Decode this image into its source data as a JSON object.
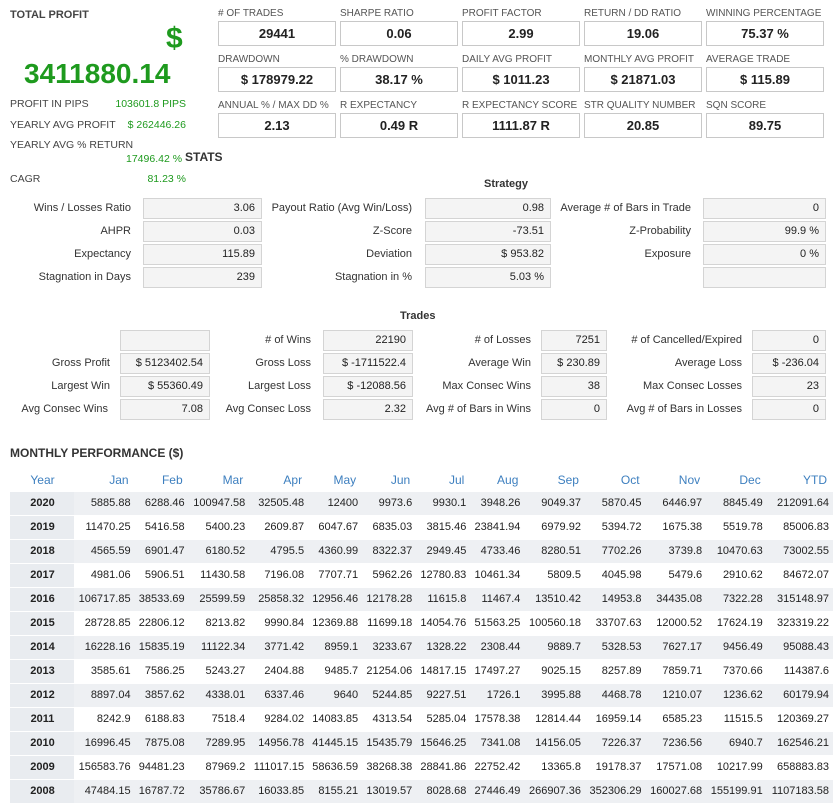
{
  "summary": {
    "title": "TOTAL PROFIT",
    "currency_symbol": "$",
    "total_profit": "3411880.14",
    "rows": [
      {
        "label": "PROFIT IN PIPS",
        "value": "103601.8 PIPS"
      },
      {
        "label": "YEARLY AVG PROFIT",
        "value": "$ 262446.26"
      },
      {
        "label": "YEARLY AVG % RETURN",
        "value": "17496.42 %"
      },
      {
        "label": "CAGR",
        "value": "81.23 %"
      }
    ]
  },
  "metrics": [
    {
      "label": "# OF TRADES",
      "value": "29441"
    },
    {
      "label": "SHARPE RATIO",
      "value": "0.06"
    },
    {
      "label": "PROFIT FACTOR",
      "value": "2.99"
    },
    {
      "label": "RETURN / DD RATIO",
      "value": "19.06"
    },
    {
      "label": "WINNING PERCENTAGE",
      "value": "75.37 %"
    },
    {
      "label": "DRAWDOWN",
      "value": "$ 178979.22"
    },
    {
      "label": "% DRAWDOWN",
      "value": "38.17 %"
    },
    {
      "label": "DAILY AVG PROFIT",
      "value": "$ 1011.23"
    },
    {
      "label": "MONTHLY AVG PROFIT",
      "value": "$ 21871.03"
    },
    {
      "label": "AVERAGE TRADE",
      "value": "$ 115.89"
    },
    {
      "label": "ANNUAL % / MAX DD %",
      "value": "2.13"
    },
    {
      "label": "R EXPECTANCY",
      "value": "0.49 R"
    },
    {
      "label": "R EXPECTANCY SCORE",
      "value": "1111.87 R"
    },
    {
      "label": "STR QUALITY NUMBER",
      "value": "20.85"
    },
    {
      "label": "SQN SCORE",
      "value": "89.75"
    }
  ],
  "stats_title": "STATS",
  "strategy": {
    "title": "Strategy",
    "rows": [
      [
        {
          "label": "Wins / Losses Ratio",
          "value": "3.06"
        },
        {
          "label": "Payout Ratio (Avg Win/Loss)",
          "value": "0.98"
        },
        {
          "label": "Average # of Bars in Trade",
          "value": "0"
        }
      ],
      [
        {
          "label": "AHPR",
          "value": "0.03"
        },
        {
          "label": "Z-Score",
          "value": "-73.51"
        },
        {
          "label": "Z-Probability",
          "value": "99.9 %"
        }
      ],
      [
        {
          "label": "Expectancy",
          "value": "115.89"
        },
        {
          "label": "Deviation",
          "value": "$ 953.82"
        },
        {
          "label": "Exposure",
          "value": "0 %"
        }
      ],
      [
        {
          "label": "Stagnation in Days",
          "value": "239"
        },
        {
          "label": "Stagnation in %",
          "value": "5.03 %"
        },
        {
          "label": "",
          "value": ""
        }
      ]
    ]
  },
  "trades": {
    "title": "Trades",
    "rows": [
      [
        {
          "label": "",
          "value": ""
        },
        {
          "label": "# of Wins",
          "value": "22190"
        },
        {
          "label": "# of Losses",
          "value": "7251"
        },
        {
          "label": "# of Cancelled/Expired",
          "value": "0"
        }
      ],
      [
        {
          "label": "Gross Profit",
          "value": "$ 5123402.54"
        },
        {
          "label": "Gross Loss",
          "value": "$ -1711522.4"
        },
        {
          "label": "Average Win",
          "value": "$ 230.89"
        },
        {
          "label": "Average Loss",
          "value": "$ -236.04"
        }
      ],
      [
        {
          "label": "Largest Win",
          "value": "$ 55360.49"
        },
        {
          "label": "Largest Loss",
          "value": "$ -12088.56"
        },
        {
          "label": "Max Consec Wins",
          "value": "38"
        },
        {
          "label": "Max Consec Losses",
          "value": "23"
        }
      ],
      [
        {
          "label": "Avg Consec Wins",
          "value": "7.08"
        },
        {
          "label": "Avg Consec Loss",
          "value": "2.32"
        },
        {
          "label": "Avg # of Bars in Wins",
          "value": "0"
        },
        {
          "label": "Avg # of Bars in Losses",
          "value": "0"
        }
      ]
    ]
  },
  "monthly": {
    "title": "MONTHLY PERFORMANCE ($)",
    "headers": [
      "Year",
      "Jan",
      "Feb",
      "Mar",
      "Apr",
      "May",
      "Jun",
      "Jul",
      "Aug",
      "Sep",
      "Oct",
      "Nov",
      "Dec",
      "YTD"
    ],
    "rows": [
      [
        "2020",
        "5885.88",
        "6288.46",
        "100947.58",
        "32505.48",
        "12400",
        "9973.6",
        "9930.1",
        "3948.26",
        "9049.37",
        "5870.45",
        "6446.97",
        "8845.49",
        "212091.64"
      ],
      [
        "2019",
        "11470.25",
        "5416.58",
        "5400.23",
        "2609.87",
        "6047.67",
        "6835.03",
        "3815.46",
        "23841.94",
        "6979.92",
        "5394.72",
        "1675.38",
        "5519.78",
        "85006.83"
      ],
      [
        "2018",
        "4565.59",
        "6901.47",
        "6180.52",
        "4795.5",
        "4360.99",
        "8322.37",
        "2949.45",
        "4733.46",
        "8280.51",
        "7702.26",
        "3739.8",
        "10470.63",
        "73002.55"
      ],
      [
        "2017",
        "4981.06",
        "5906.51",
        "11430.58",
        "7196.08",
        "7707.71",
        "5962.26",
        "12780.83",
        "10461.34",
        "5809.5",
        "4045.98",
        "5479.6",
        "2910.62",
        "84672.07"
      ],
      [
        "2016",
        "106717.85",
        "38533.69",
        "25599.59",
        "25858.32",
        "12956.46",
        "12178.28",
        "11615.8",
        "11467.4",
        "13510.42",
        "14953.8",
        "34435.08",
        "7322.28",
        "315148.97"
      ],
      [
        "2015",
        "28728.85",
        "22806.12",
        "8213.82",
        "9990.84",
        "12369.88",
        "11699.18",
        "14054.76",
        "51563.25",
        "100560.18",
        "33707.63",
        "12000.52",
        "17624.19",
        "323319.22"
      ],
      [
        "2014",
        "16228.16",
        "15835.19",
        "11122.34",
        "3771.42",
        "8959.1",
        "3233.67",
        "1328.22",
        "2308.44",
        "9889.7",
        "5328.53",
        "7627.17",
        "9456.49",
        "95088.43"
      ],
      [
        "2013",
        "3585.61",
        "7586.25",
        "5243.27",
        "2404.88",
        "9485.7",
        "21254.06",
        "14817.15",
        "17497.27",
        "9025.15",
        "8257.89",
        "7859.71",
        "7370.66",
        "114387.6"
      ],
      [
        "2012",
        "8897.04",
        "3857.62",
        "4338.01",
        "6337.46",
        "9640",
        "5244.85",
        "9227.51",
        "1726.1",
        "3995.88",
        "4468.78",
        "1210.07",
        "1236.62",
        "60179.94"
      ],
      [
        "2011",
        "8242.9",
        "6188.83",
        "7518.4",
        "9284.02",
        "14083.85",
        "4313.54",
        "5285.04",
        "17578.38",
        "12814.44",
        "16959.14",
        "6585.23",
        "11515.5",
        "120369.27"
      ],
      [
        "2010",
        "16996.45",
        "7875.08",
        "7289.95",
        "14956.78",
        "41445.15",
        "15435.79",
        "15646.25",
        "7341.08",
        "14156.05",
        "7226.37",
        "7236.56",
        "6940.7",
        "162546.21"
      ],
      [
        "2009",
        "156583.76",
        "94481.23",
        "87969.2",
        "111017.15",
        "58636.59",
        "38268.38",
        "28841.86",
        "22752.42",
        "13365.8",
        "19178.37",
        "17571.08",
        "10217.99",
        "658883.83"
      ],
      [
        "2008",
        "47484.15",
        "16787.72",
        "35786.67",
        "16033.85",
        "8155.21",
        "13019.57",
        "8028.68",
        "27446.49",
        "266907.36",
        "352306.29",
        "160027.68",
        "155199.91",
        "1107183.58"
      ]
    ]
  }
}
